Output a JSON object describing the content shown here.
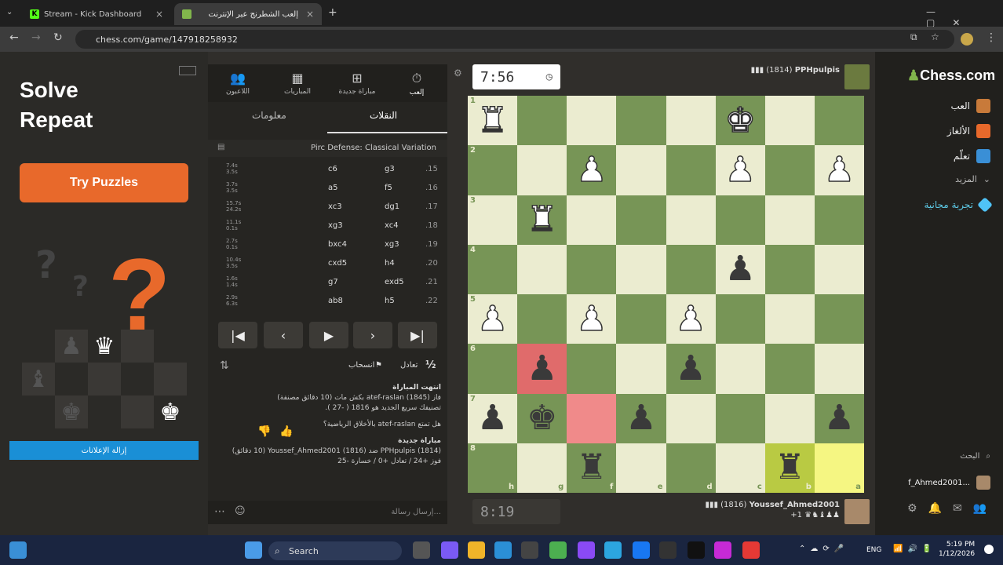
{
  "browser": {
    "tabs": [
      {
        "title": "Stream - Kick Dashboard"
      },
      {
        "title": "إلعب الشطرنج عبر الإنترنت"
      }
    ],
    "url": "chess.com/game/147918258932"
  },
  "ad": {
    "headline_line1": "Solve",
    "headline_line2": "Repeat",
    "button": "Try Puzzles",
    "remove_ads": "إزالة الإعلانات"
  },
  "panel": {
    "tabs": [
      "اللاعبون",
      "المباريات",
      "مباراة جديدة",
      "إلعب"
    ],
    "subtabs": {
      "moves": "النقلات",
      "info": "معلومات"
    },
    "opening": "Pirc Defense: Classical Variation",
    "moves": [
      {
        "num": ".15",
        "white": "g3",
        "black": "c6",
        "t1": "7.4s",
        "t2": "3.5s"
      },
      {
        "num": ".16",
        "white": "f5",
        "black": "a5",
        "t1": "3.7s",
        "t2": "3.5s"
      },
      {
        "num": ".17",
        "white": "dg1",
        "black": "xc3",
        "t1": "15.7s",
        "t2": "24.2s"
      },
      {
        "num": ".18",
        "white": "xc4",
        "black": "xg3",
        "t1": "11.1s",
        "t2": "0.1s"
      },
      {
        "num": ".19",
        "white": "xg3",
        "black": "bxc4",
        "t1": "2.7s",
        "t2": "0.1s"
      },
      {
        "num": ".20",
        "white": "h4",
        "black": "cxd5",
        "t1": "10.4s",
        "t2": "3.5s"
      },
      {
        "num": ".21",
        "white": "exd5",
        "black": "g7",
        "t1": "1.6s",
        "t2": "1.4s"
      },
      {
        "num": ".22",
        "white": "h5",
        "black": "ab8",
        "t1": "2.9s",
        "t2": "6.3s"
      }
    ],
    "draw": "تعادل",
    "resign": "انسحاب",
    "half": "½",
    "chat": {
      "title": "انتهت المباراة",
      "line1": "فاز atef-raslan (1845) بكش مات (10 دقائق مصنفة)",
      "line2": "تصنيفك سريع الجديد هو 1816 ( -27 ).",
      "line3": "هل تمتع atef-raslan بالأخلاق الرياضية؟",
      "new_title": "مباراة جديدة",
      "new_line": "PPHpulpis (1814) ضد Youssef_Ahmed2001 (1816) (10 دقائق)",
      "record": "فوز +24 / تعادل +0 / خسارة -25"
    },
    "chat_placeholder": "إرسال رسالة..."
  },
  "game": {
    "timer_top": "7:56",
    "timer_bottom": "8:19",
    "player_top": "PPHpulpis",
    "rating_top": "(1814)",
    "player_bottom": "Youssef_Ahmed2001",
    "rating_bottom": "(1816)",
    "captured_bottom": "+1"
  },
  "board": {
    "ranks": [
      "1",
      "2",
      "3",
      "4",
      "5",
      "6",
      "7",
      "8"
    ],
    "files": [
      "h",
      "g",
      "f",
      "e",
      "d",
      "c",
      "b",
      "a"
    ],
    "rows": [
      [
        "wR",
        "",
        "",
        "",
        "",
        "wK",
        "",
        ""
      ],
      [
        "",
        "",
        "wP",
        "",
        "",
        "wP",
        "",
        "wP"
      ],
      [
        "",
        "wR",
        "",
        "",
        "",
        "",
        "",
        ""
      ],
      [
        "",
        "",
        "",
        "",
        "",
        "bP",
        "",
        ""
      ],
      [
        "wP",
        "",
        "wP",
        "",
        "wP",
        "",
        "",
        ""
      ],
      [
        "",
        "bP",
        "",
        "",
        "bP",
        "",
        "",
        ""
      ],
      [
        "bP",
        "bK",
        "",
        "bP",
        "",
        "",
        "",
        "bP"
      ],
      [
        "",
        "",
        "bR",
        "",
        "",
        "",
        "bR",
        ""
      ]
    ],
    "highlights": {
      "6-1": "hr",
      "7-2": "hr2",
      "8-6": "hy2",
      "8-7": "hy"
    }
  },
  "rightnav": {
    "logo": "Chess.com",
    "items": [
      "العب",
      "الألغاز",
      "تعلّم",
      "المزيد",
      "تجربة مجانية"
    ],
    "search": "البحث",
    "user": "f_Ahmed2001..."
  },
  "taskbar": {
    "search": "Search",
    "lang": "ENG",
    "time": "5:19 PM",
    "date": "1/12/2026"
  },
  "colors": {
    "board_light": "#ebecd0",
    "board_dark": "#779556",
    "accent_orange": "#e8692b",
    "accent_green": "#81b64c"
  }
}
